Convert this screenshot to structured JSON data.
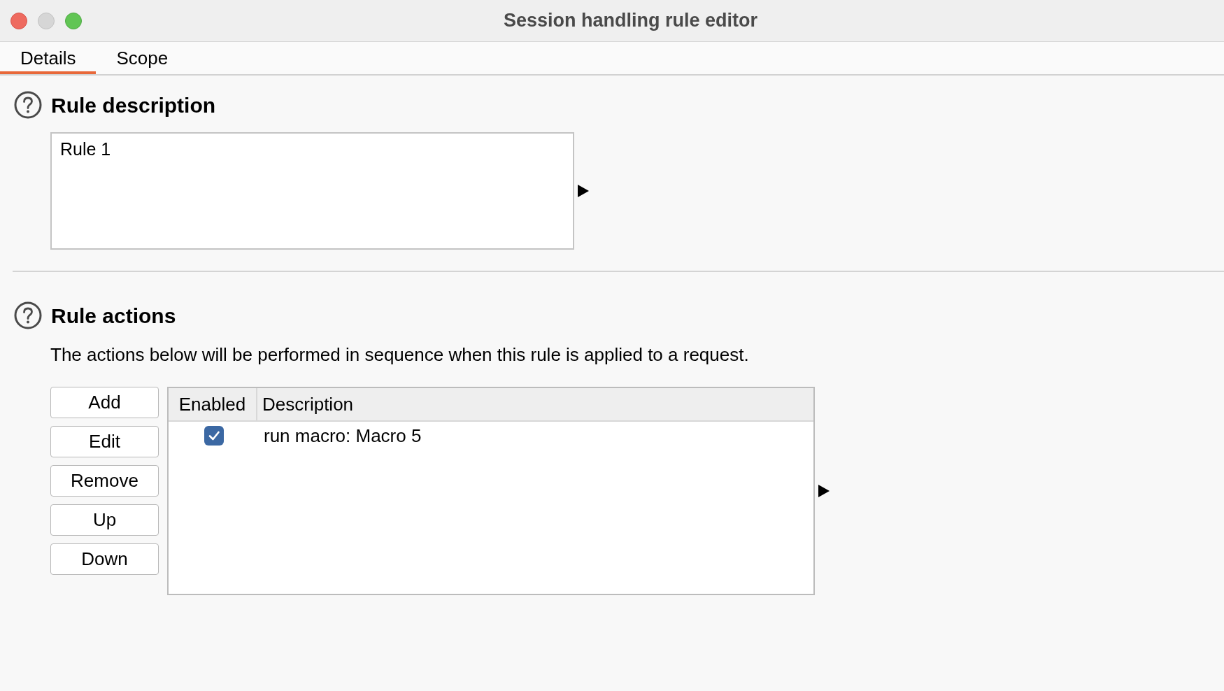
{
  "window": {
    "title": "Session handling rule editor",
    "buttons": [
      {
        "kind": "close",
        "disabled": false
      },
      {
        "kind": "minimize",
        "disabled": true
      },
      {
        "kind": "zoom",
        "disabled": false
      }
    ]
  },
  "tabs": [
    {
      "label": "Details",
      "selected": true
    },
    {
      "label": "Scope",
      "selected": false
    }
  ],
  "rule_description": {
    "heading": "Rule description",
    "value": "Rule 1"
  },
  "rule_actions": {
    "heading": "Rule actions",
    "description": "The actions below will be performed in sequence when this rule is applied to a request.",
    "buttons": [
      "Add",
      "Edit",
      "Remove",
      "Up",
      "Down"
    ],
    "table": {
      "columns": [
        "Enabled",
        "Description"
      ],
      "rows": [
        {
          "enabled": true,
          "description": "run macro: Macro 5"
        }
      ]
    }
  }
}
